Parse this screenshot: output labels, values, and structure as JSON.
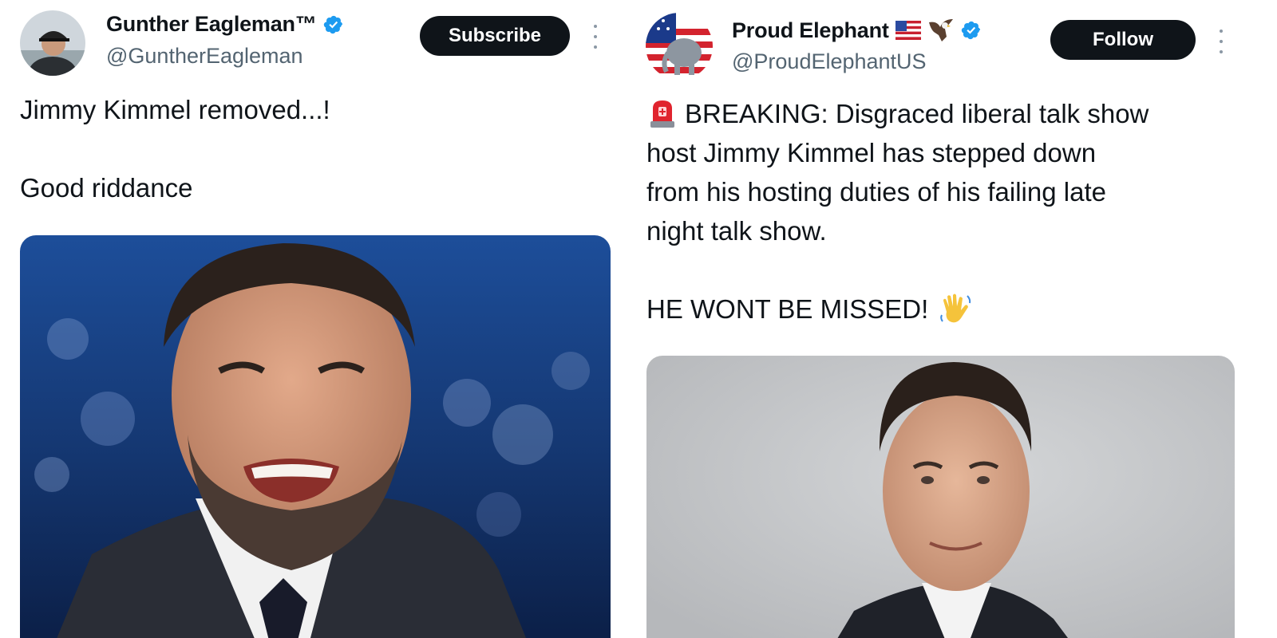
{
  "left_tweet": {
    "display_name": "Gunther Eagleman™",
    "handle": "@GuntherEagleman",
    "action_label": "Subscribe",
    "text_line1": "Jimmy Kimmel removed...!",
    "text_line2": "Good riddance"
  },
  "right_tweet": {
    "display_name": "Proud Elephant",
    "handle": "@ProudElephantUS",
    "action_label": "Follow",
    "text_lines": [
      "BREAKING: Disgraced liberal talk show",
      "host Jimmy Kimmel has stepped down",
      "from his hosting duties of his failing late",
      "night talk show."
    ],
    "text_final": "HE WONT BE MISSED!"
  },
  "colors": {
    "verified_blue": "#1d9bf0",
    "button_bg": "#0f1419",
    "handle_gray": "#536471",
    "text": "#0f1419"
  },
  "icons": [
    "verified-badge-icon",
    "more-options-icon",
    "us-flag-emoji",
    "eagle-emoji",
    "police-light-emoji",
    "waving-hand-emoji"
  ]
}
